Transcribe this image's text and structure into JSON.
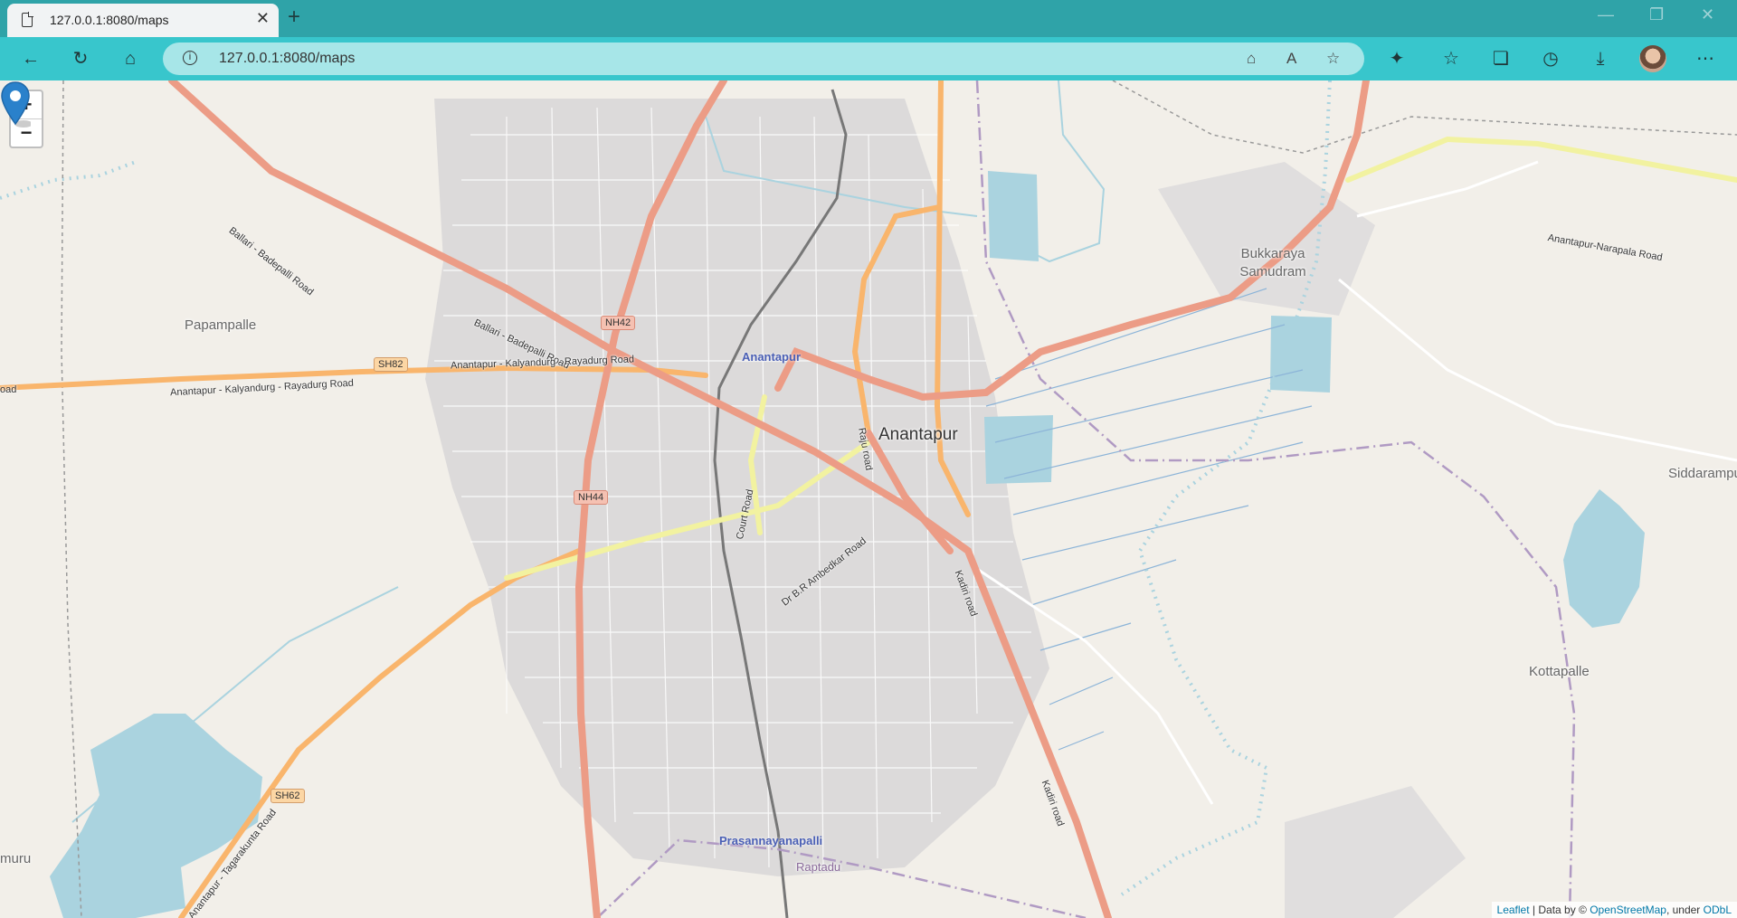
{
  "browser": {
    "tab_title": "127.0.0.1:8080/maps",
    "url": "127.0.0.1:8080/maps",
    "icons": {
      "back": "arrow-left",
      "refresh": "refresh",
      "home": "home",
      "info": "info",
      "extensions": "puzzle",
      "favorites": "star-list",
      "collections": "collections",
      "history": "history",
      "downloads": "download",
      "more": "ellipsis"
    }
  },
  "map": {
    "zoom_in": "+",
    "zoom_out": "−",
    "places": {
      "anantapur": "Anantapur",
      "anantapur_station": "Anantapur",
      "bukkaraya": "Bukkaraya Samudram",
      "papampalle": "Papampalle",
      "siddarampur": "Siddarampur",
      "kottapalle": "Kottapalle",
      "prasannayanapalli": "Prasannayanapalli",
      "raptadu": "Raptadu",
      "left_edge": "muru"
    },
    "roads": {
      "ballari1": "Ballari - Badepalli Road",
      "ballari2": "Ballari - Badepalli Road",
      "kalyandurg1": "Anantapur - Kalyandurg - Rayadurg Road",
      "kalyandurg2": "Anantapur - Kalyandurg - Rayadurg Road",
      "narapala": "Anantapur-Narapala Road",
      "court": "Court Road",
      "raju": "Raju road",
      "ambedkar": "Dr B.R Ambedkar Road",
      "kadiri1": "Kadiri road",
      "kadiri2": "Kadiri road",
      "tagarakunta": "Anantapur - Tagarakunta Road",
      "left_road": "oad"
    },
    "shields": {
      "nh42": "NH42",
      "nh44": "NH44",
      "sh82": "SH82",
      "sh62": "SH62"
    },
    "attribution": {
      "leaflet": "Leaflet",
      "data_by": " | Data by © ",
      "osm": "OpenStreetMap",
      "under": ", under ",
      "odbl": "ODbL"
    }
  }
}
